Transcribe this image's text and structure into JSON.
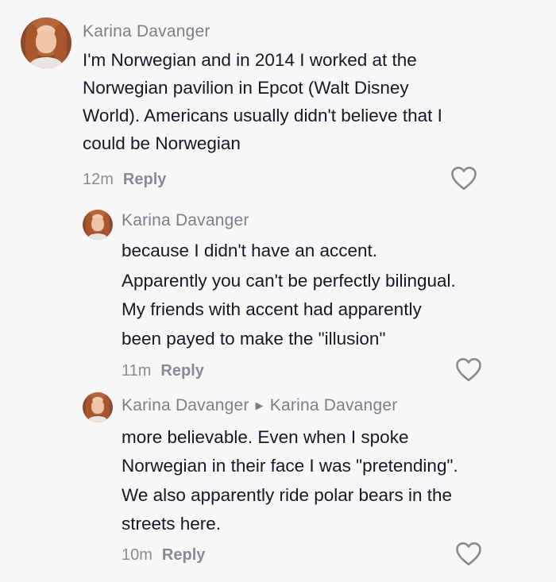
{
  "comments": [
    {
      "username": "Karina Davanger",
      "lines": [
        "I'm Norwegian and in 2014 I worked at the",
        "Norwegian pavilion in Epcot (Walt Disney",
        "World). Americans usually didn't believe that I",
        "could be Norwegian"
      ],
      "time": "12m",
      "reply_label": "Reply",
      "like_icon": "heart-outline-icon"
    },
    {
      "username": "Karina Davanger",
      "lines": [
        "because I didn't have an accent.",
        "Apparently you can't be perfectly bilingual.",
        "My friends with accent had apparently",
        "been payed to make the \"illusion\""
      ],
      "time": "11m",
      "reply_label": "Reply",
      "like_icon": "heart-outline-icon"
    },
    {
      "username": "Karina Davanger",
      "reply_to": "Karina Davanger",
      "lines": [
        "more believable. Even when I spoke",
        "Norwegian in their face I was \"pretending\".",
        "We also apparently ride polar bears in the",
        "streets here."
      ],
      "time": "10m",
      "reply_label": "Reply",
      "like_icon": "heart-outline-icon"
    }
  ],
  "colors": {
    "background": "#f7f7f7",
    "username": "#7d7f86",
    "text": "#161823",
    "meta": "#8a8b91"
  }
}
